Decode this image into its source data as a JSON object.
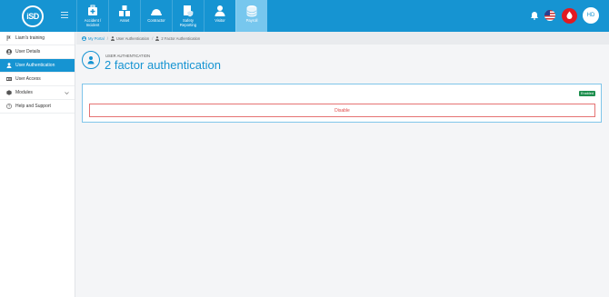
{
  "header": {
    "logo_text": "iSD",
    "nav": [
      {
        "label": "Accident /\nIncident",
        "icon": "first-aid-kit-icon"
      },
      {
        "label": "Asset",
        "icon": "assets-icon"
      },
      {
        "label": "Contractor",
        "icon": "hard-hat-icon"
      },
      {
        "label": "Safety\nReporting",
        "icon": "safety-report-icon"
      },
      {
        "label": "Visitor",
        "icon": "visitor-icon"
      },
      {
        "label": "Payroll",
        "icon": "payroll-icon"
      }
    ],
    "active_nav": "Payroll",
    "avatar_initials": "HD"
  },
  "sidebar": {
    "items": [
      {
        "label": "Liam's training",
        "icon": "training-icon"
      },
      {
        "label": "User Details",
        "icon": "user-circle-icon"
      },
      {
        "label": "User Authentication",
        "icon": "user-lock-icon",
        "active": true
      },
      {
        "label": "User Access",
        "icon": "id-card-icon"
      },
      {
        "label": "Modules",
        "icon": "modules-icon",
        "has_chevron": true
      },
      {
        "label": "Help and Support",
        "icon": "help-icon"
      }
    ]
  },
  "breadcrumb": {
    "home": "My Portal",
    "section": "User Authentication",
    "current": "2 Factor Authentication"
  },
  "page": {
    "subtitle": "USER AUTHENTICATION",
    "title": "2 factor authentication"
  },
  "panel": {
    "status_badge": "Enabled",
    "disable_label": "Disable"
  },
  "colors": {
    "brand": "#1694d2",
    "active_nav": "#77c7ee",
    "badge": "#1e8f4e",
    "danger": "#e04848"
  }
}
